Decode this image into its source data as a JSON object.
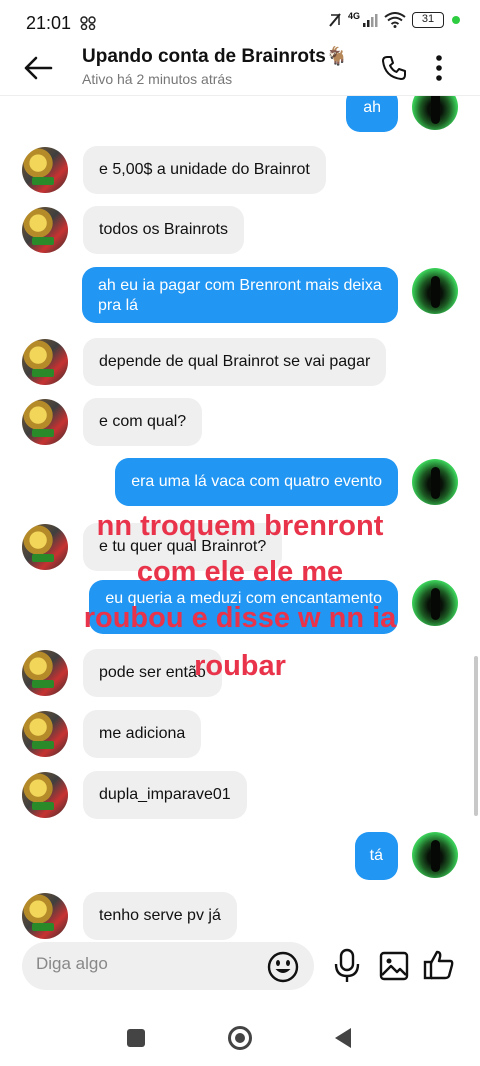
{
  "status_bar": {
    "time": "21:01",
    "network": "4G",
    "battery": "31"
  },
  "header": {
    "title": "Upando conta de Brainrots",
    "title_emoji": "🐐",
    "subtitle": "Ativo há 2 minutos atrás"
  },
  "messages": [
    {
      "from": "me",
      "text": "ah"
    },
    {
      "from": "them",
      "text": "e 5,00$ a unidade do Brainrot"
    },
    {
      "from": "them",
      "text": "todos os Brainrots"
    },
    {
      "from": "me",
      "text": "ah eu ia pagar com Brenront mais deixa pra lá"
    },
    {
      "from": "them",
      "text": "depende de qual Brainrot se vai pagar"
    },
    {
      "from": "them",
      "text": "e com qual?"
    },
    {
      "from": "me",
      "text": "era uma lá vaca com quatro evento"
    },
    {
      "from": "them",
      "text": "e tu quer qual Brainrot?"
    },
    {
      "from": "me",
      "text": "eu queria a meduzi com encantamento"
    },
    {
      "from": "them",
      "text": "pode ser então"
    },
    {
      "from": "them",
      "text": "me adiciona"
    },
    {
      "from": "them",
      "text": "dupla_imparave01"
    },
    {
      "from": "me",
      "text": "tá"
    },
    {
      "from": "them",
      "text": "tenho serve pv já"
    }
  ],
  "overlay_lines": [
    "nn troquem brenront",
    "com ele ele me",
    "roubou e disse w nn ia",
    "roubar"
  ],
  "composer": {
    "placeholder": "Diga algo"
  },
  "colors": {
    "outgoing_bubble": "#2196f3",
    "incoming_bubble": "#efefef",
    "overlay_text": "#e8334a"
  }
}
